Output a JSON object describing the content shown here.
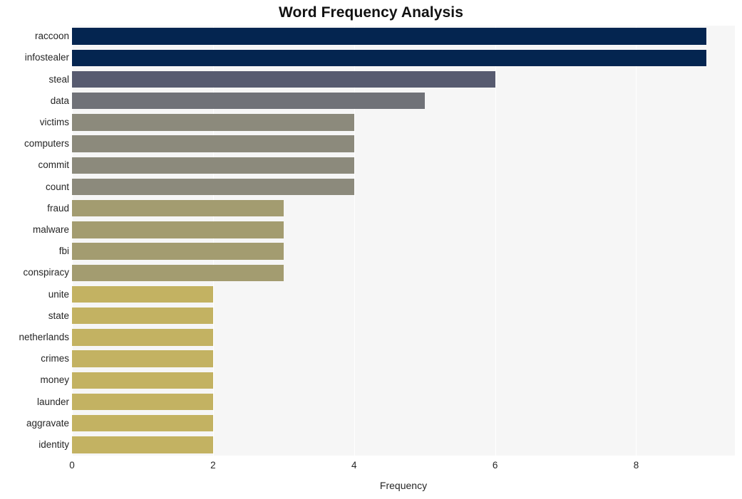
{
  "chart_data": {
    "type": "bar",
    "orientation": "horizontal",
    "title": "Word Frequency Analysis",
    "xlabel": "Frequency",
    "ylabel": "",
    "categories": [
      "raccoon",
      "infostealer",
      "steal",
      "data",
      "victims",
      "computers",
      "commit",
      "count",
      "fraud",
      "malware",
      "fbi",
      "conspiracy",
      "unite",
      "state",
      "netherlands",
      "crimes",
      "money",
      "launder",
      "aggravate",
      "identity"
    ],
    "values": [
      9,
      9,
      6,
      5,
      4,
      4,
      4,
      4,
      3,
      3,
      3,
      3,
      2,
      2,
      2,
      2,
      2,
      2,
      2,
      2
    ],
    "bar_colors": [
      "#042550",
      "#042550",
      "#575b70",
      "#707278",
      "#8c8a7c",
      "#8c8a7c",
      "#8c8a7c",
      "#8c8a7c",
      "#a39c70",
      "#a39c70",
      "#a39c70",
      "#a39c70",
      "#c3b262",
      "#c3b262",
      "#c3b262",
      "#c3b262",
      "#c3b262",
      "#c3b262",
      "#c3b262",
      "#c3b262"
    ],
    "xticks": [
      0,
      2,
      4,
      6,
      8
    ],
    "xtick_labels": [
      "0",
      "2",
      "4",
      "6",
      "8"
    ],
    "xlim": [
      0,
      9.4
    ],
    "grid": "vertical",
    "legend": "none",
    "plot_background": "#f6f6f6",
    "figure_background": "#ffffff",
    "gridline_color": "#ffffff"
  }
}
